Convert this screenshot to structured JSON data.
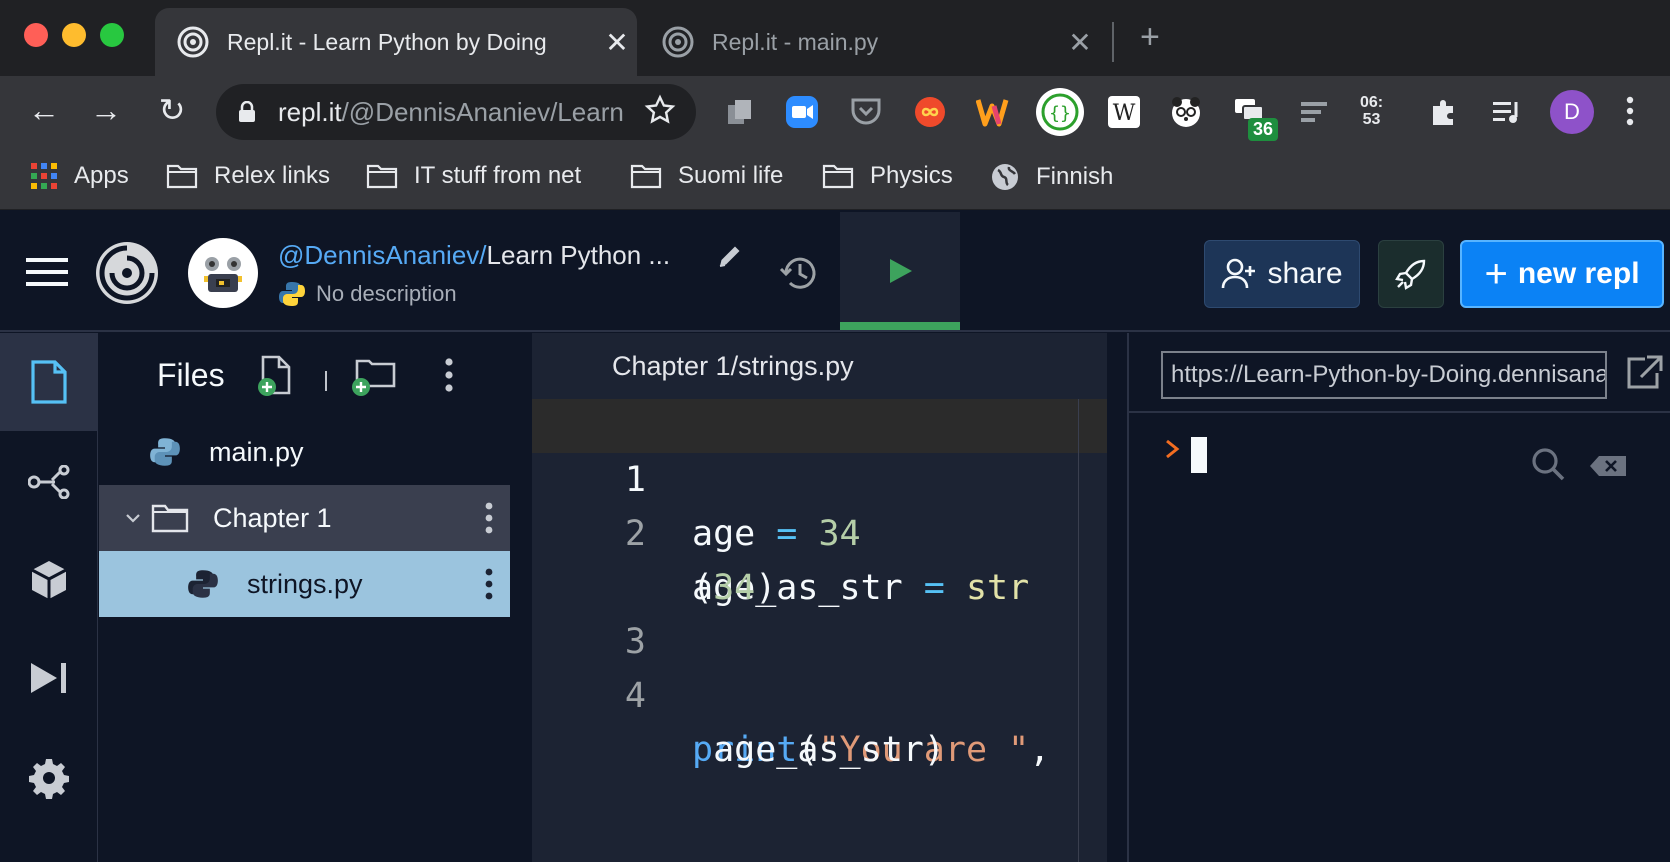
{
  "browser": {
    "tabs": [
      {
        "title": "Repl.it - Learn Python by Doing",
        "active": true
      },
      {
        "title": "Repl.it - main.py",
        "active": false
      }
    ],
    "close_glyph": "✕",
    "new_tab_glyph": "+",
    "nav": {
      "back": "←",
      "forward": "→",
      "reload": "↻"
    },
    "url": {
      "host": "repl.it",
      "path": "/@DennisAnaniev/Learn-Python-by-Doing"
    },
    "extensions": [
      "copy-icon",
      "zoom-icon",
      "pocket-icon",
      "infinity-icon",
      "w-icon",
      "stitch-icon",
      "wikipedia-icon",
      "panda-icon",
      "chat-icon",
      "lines-icon",
      "clock-icon",
      "puzzle-icon",
      "playlist-icon"
    ],
    "ext_wikipedia_letter": "W",
    "ext_badge": "36",
    "ext_clock": {
      "line1": "06:",
      "line2": "53"
    },
    "profile_initial": "D",
    "bookmarks": [
      {
        "label": "Apps",
        "icon": "apps-grid-icon"
      },
      {
        "label": "Relex links",
        "icon": "folder-icon"
      },
      {
        "label": "IT stuff from net",
        "icon": "folder-icon"
      },
      {
        "label": "Suomi life",
        "icon": "folder-icon"
      },
      {
        "label": "Physics",
        "icon": "folder-icon"
      },
      {
        "label": "Finnish",
        "icon": "globe-icon"
      }
    ]
  },
  "repl": {
    "owner": "@DennisAnaniev",
    "separator": "/",
    "project": "Learn Python ...",
    "description": "No description",
    "share_label": "share",
    "new_repl_label": "new repl",
    "new_repl_plus": "+"
  },
  "files": {
    "title": "Files",
    "tree": [
      {
        "name": "main.py",
        "type": "python-file"
      },
      {
        "name": "Chapter 1",
        "type": "folder",
        "expanded": true
      },
      {
        "name": "strings.py",
        "type": "python-file",
        "selected": true
      }
    ]
  },
  "editor": {
    "path": "Chapter 1/strings.py",
    "lines": [
      {
        "num": "1"
      },
      {
        "num": "2"
      },
      {
        "num": "3"
      },
      {
        "num": "4"
      }
    ],
    "tokens": {
      "l1_a": "age ",
      "l1_op": "=",
      "l1_num": " 34",
      "l2_a": "age_as_str ",
      "l2_op": "=",
      "l2_fn": " str",
      "l2w_a": "(",
      "l2w_num": "34",
      "l2w_b": ")",
      "l4_kw": "print",
      "l4_p": "(",
      "l4_str": "\"You are \"",
      "l4_c": ",",
      "l4w": " age_as_str)"
    }
  },
  "console": {
    "webview_url": "https://Learn-Python-by-Doing.dennisananiev.repl.co",
    "prompt_glyph": "›"
  },
  "colors": {
    "accent_blue": "#0b82f5",
    "run_green": "#3da35d",
    "bg": "#0e1525",
    "selected_file": "#9bc4de"
  }
}
